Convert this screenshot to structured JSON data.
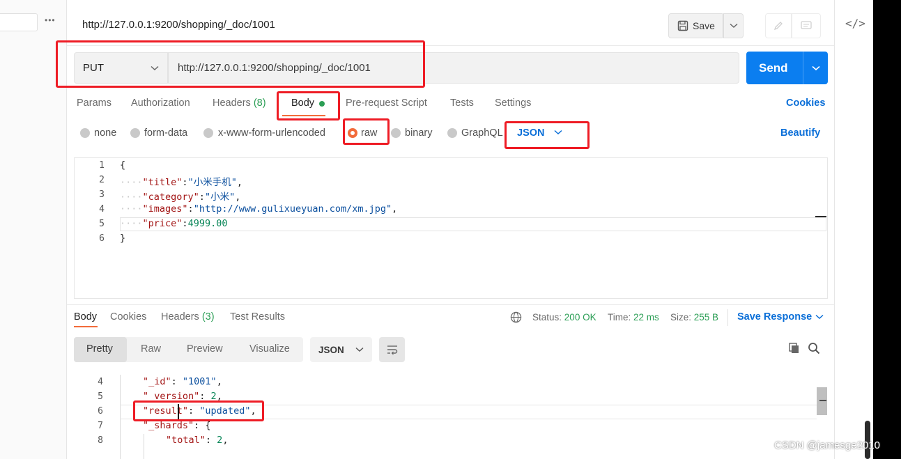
{
  "header": {
    "title": "http://127.0.0.1:9200/shopping/_doc/1001",
    "save_label": "Save"
  },
  "request": {
    "method": "PUT",
    "url": "http://127.0.0.1:9200/shopping/_doc/1001",
    "send_label": "Send"
  },
  "tabs": {
    "params": "Params",
    "authorization": "Authorization",
    "headers": "Headers",
    "headers_count": "(8)",
    "body": "Body",
    "prerequest": "Pre-request Script",
    "tests": "Tests",
    "settings": "Settings",
    "cookies": "Cookies"
  },
  "body_types": {
    "none": "none",
    "form_data": "form-data",
    "urlencoded": "x-www-form-urlencoded",
    "raw": "raw",
    "binary": "binary",
    "graphql": "GraphQL",
    "format": "JSON",
    "beautify": "Beautify"
  },
  "editor": {
    "line_numbers": [
      "1",
      "2",
      "3",
      "4",
      "5",
      "6"
    ],
    "open_brace": "{",
    "close_brace": "}",
    "indent": "····",
    "lines": [
      {
        "key": "\"title\"",
        "sep": ":",
        "value": "\"小米手机\"",
        "end": ","
      },
      {
        "key": "\"category\"",
        "sep": ":",
        "value": "\"小米\"",
        "end": ","
      },
      {
        "key": "\"images\"",
        "sep": ":",
        "value": "\"http://www.gulixueyuan.com/xm.jpg\"",
        "end": ","
      },
      {
        "key": "\"price\"",
        "sep": ":",
        "value": "4999.00",
        "end": ""
      }
    ]
  },
  "response": {
    "tabs": {
      "body": "Body",
      "cookies": "Cookies",
      "headers": "Headers",
      "headers_count": "(3)",
      "test_results": "Test Results"
    },
    "status_label": "Status:",
    "status_value": "200 OK",
    "time_label": "Time:",
    "time_value": "22 ms",
    "size_label": "Size:",
    "size_value": "255 B",
    "save_response": "Save Response",
    "views": {
      "pretty": "Pretty",
      "raw": "Raw",
      "preview": "Preview",
      "visualize": "Visualize"
    },
    "format": "JSON",
    "line_numbers": [
      "4",
      "5",
      "6",
      "7",
      "8"
    ],
    "code": {
      "id_key": "\"_id\"",
      "id_val": "\"1001\"",
      "version_key": "\"_version\"",
      "version_val": "2",
      "result_key": "\"result\"",
      "result_val": "\"updated\"",
      "shards_key": "\"_shards\"",
      "shards_open": "{",
      "total_key": "\"total\"",
      "total_val": "2"
    }
  },
  "watermark": "CSDN @jamesge2010",
  "colors": {
    "send_button": "#0b7ef0",
    "accent_orange": "#f26b3a",
    "link_blue": "#0b6fd8",
    "status_green": "#2b9e55",
    "annotation_red": "#ee1c25"
  }
}
